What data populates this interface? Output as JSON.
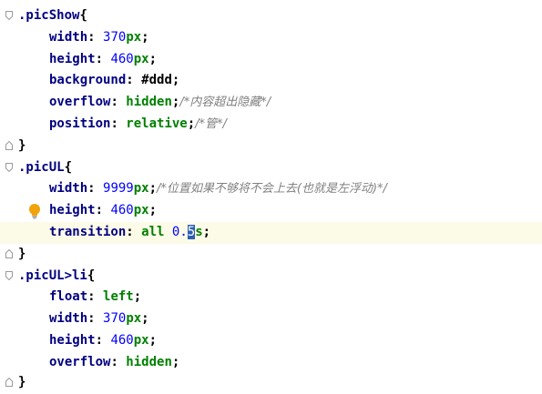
{
  "colors": {
    "selector": "#000080",
    "property": "#000080",
    "number": "#0000ff",
    "unit": "#008000",
    "keyword": "#008000",
    "comment": "#808080",
    "current_line_bg": "#fcfbe8",
    "cursor_bg": "#2d5fb2"
  },
  "icons": {
    "fold_marker": "fold-marker-icon",
    "intention_bulb": "lightbulb-icon"
  },
  "code": {
    "l1": {
      "selector": ".picShow",
      "open": "{"
    },
    "l2": {
      "prop": "width",
      "colon": ": ",
      "num": "370",
      "unit": "px",
      "semi": ";"
    },
    "l3": {
      "prop": "height",
      "colon": ": ",
      "num": "460",
      "unit": "px",
      "semi": ";"
    },
    "l4": {
      "prop": "background",
      "colon": ": ",
      "value": "#ddd",
      "semi": ";"
    },
    "l5": {
      "prop": "overflow",
      "colon": ": ",
      "kw": "hidden",
      "semi": ";",
      "comment": "/*内容超出隐藏*/"
    },
    "l6": {
      "prop": "position",
      "colon": ": ",
      "kw": "relative",
      "semi": ";",
      "comment": "/*管*/"
    },
    "l7": {
      "close": "}"
    },
    "l8": {
      "selector": ".picUL",
      "open": "{"
    },
    "l9": {
      "prop": "width",
      "colon": ": ",
      "num": "9999",
      "unit": "px",
      "semi": ";",
      "comment": "/*位置如果不够将不会上去(也就是左浮动)*/"
    },
    "l10": {
      "prop": "height",
      "colon": ": ",
      "num": "460",
      "unit": "px",
      "semi": ";"
    },
    "l11": {
      "prop": "transition",
      "colon": ": ",
      "kw": "all",
      "num_a": "0.",
      "cursor": "5",
      "tail": "s",
      "semi": ";"
    },
    "l12": {
      "close": "}"
    },
    "l13": {
      "selector": ".picUL>li",
      "open": "{"
    },
    "l14": {
      "prop": "float",
      "colon": ": ",
      "kw": "left",
      "semi": ";"
    },
    "l15": {
      "prop": "width",
      "colon": ": ",
      "num": "370",
      "unit": "px",
      "semi": ";"
    },
    "l16": {
      "prop": "height",
      "colon": ": ",
      "num": "460",
      "unit": "px",
      "semi": ";"
    },
    "l17": {
      "prop": "overflow",
      "colon": ": ",
      "kw": "hidden",
      "semi": ";"
    },
    "l18": {
      "close": "}"
    }
  }
}
